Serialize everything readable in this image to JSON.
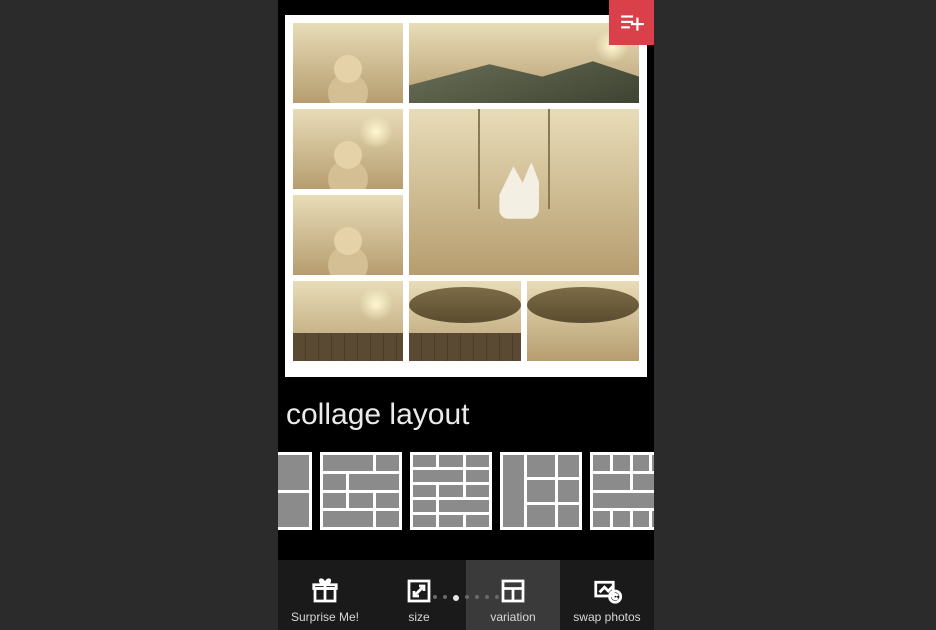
{
  "accent_color": "#d9404a",
  "section_title": "collage layout",
  "add_button_icon": "playlist-add",
  "page_indicator": {
    "count": 7,
    "active_index": 2
  },
  "toolbar": {
    "active_index": 2,
    "items": [
      {
        "label": "Surprise Me!",
        "icon": "gift"
      },
      {
        "label": "size",
        "icon": "resize"
      },
      {
        "label": "variation",
        "icon": "layout"
      },
      {
        "label": "swap photos",
        "icon": "swap"
      }
    ]
  },
  "layout_options": [
    {
      "name": "layout-2x2"
    },
    {
      "name": "layout-3x4"
    },
    {
      "name": "layout-3x5"
    },
    {
      "name": "layout-tall-center"
    },
    {
      "name": "layout-4x4"
    }
  ],
  "collage_tiles": [
    {
      "slot": "t1",
      "hint": "child-flowers"
    },
    {
      "slot": "t2",
      "hint": "sunlit-field"
    },
    {
      "slot": "t3",
      "hint": "parent-child"
    },
    {
      "slot": "t4",
      "hint": "father-daughter"
    },
    {
      "slot": "t5",
      "hint": "girl-swing-mountain"
    },
    {
      "slot": "t6",
      "hint": "bench-sunset"
    },
    {
      "slot": "t7",
      "hint": "legs-dock"
    },
    {
      "slot": "t8",
      "hint": "lake-sunset"
    }
  ]
}
